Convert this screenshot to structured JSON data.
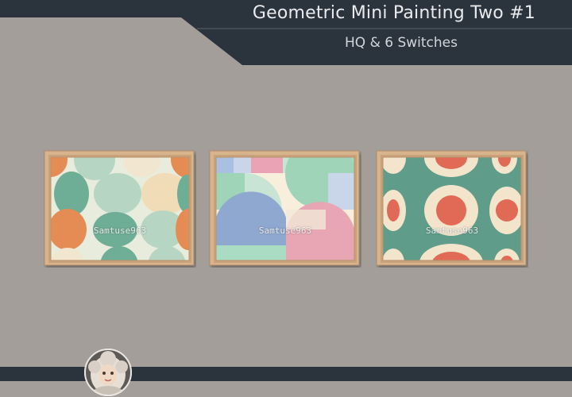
{
  "header": {
    "title": "Geometric Mini Painting Two #1",
    "subtitle": "HQ & 6 Switches"
  },
  "paintings": [
    {
      "watermark": "Samtuse963"
    },
    {
      "watermark": "Samtuse963"
    },
    {
      "watermark": "Samtuse963"
    }
  ],
  "colors": {
    "background": "#a39e99",
    "banner": "#2b333d",
    "frame": "#d8b48d",
    "sage": "#6fae96",
    "orange": "#e58c55",
    "cream": "#f1e6cf",
    "pink": "#e5a2b1",
    "blue": "#8fa7cf",
    "coral": "#e06a55",
    "teal": "#5f9c89"
  },
  "icons": {
    "avatar": "doll-portrait-icon"
  }
}
